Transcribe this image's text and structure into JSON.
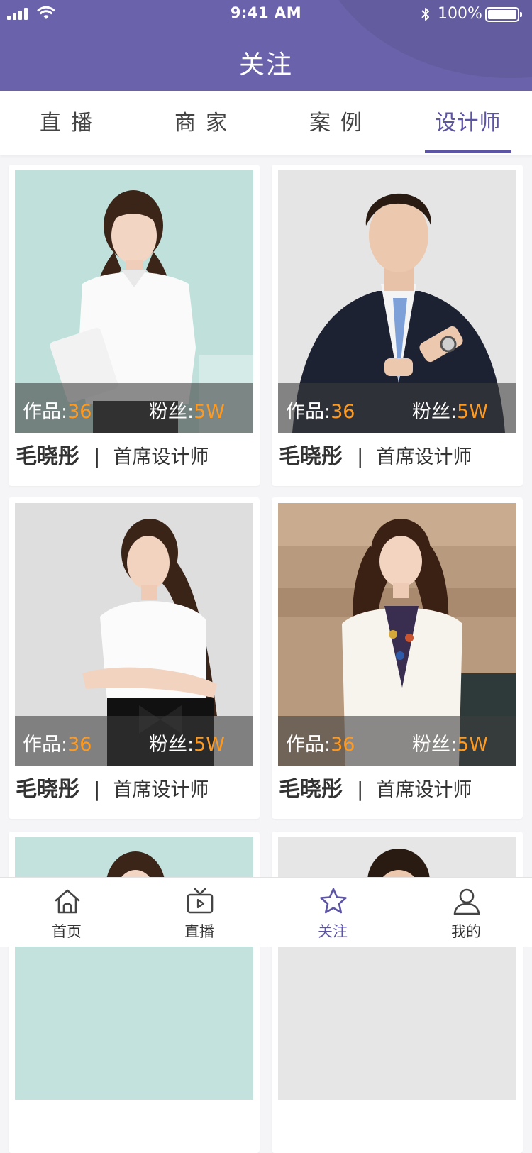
{
  "status_bar": {
    "time": "9:41 AM",
    "battery_text": "100%",
    "battery_level": 1.0
  },
  "header": {
    "title": "关注"
  },
  "tabs": [
    {
      "label": "直播",
      "active": false
    },
    {
      "label": "商家",
      "active": false
    },
    {
      "label": "案例",
      "active": false
    },
    {
      "label": "设计师",
      "active": true
    }
  ],
  "stat_labels": {
    "works": "作品",
    "fans": "粉丝"
  },
  "designers": [
    {
      "name": "毛晓彤",
      "role": "首席设计师",
      "works": "36",
      "fans": "5W",
      "photo": "woman-white-blouse"
    },
    {
      "name": "毛晓彤",
      "role": "首席设计师",
      "works": "36",
      "fans": "5W",
      "photo": "man-dark-suit"
    },
    {
      "name": "毛晓彤",
      "role": "首席设计师",
      "works": "36",
      "fans": "5W",
      "photo": "woman-folded-arms"
    },
    {
      "name": "毛晓彤",
      "role": "首席设计师",
      "works": "36",
      "fans": "5W",
      "photo": "woman-white-blazer"
    }
  ],
  "card_separator": "|",
  "bottom_nav": [
    {
      "label": "首页",
      "icon": "home-icon",
      "active": false
    },
    {
      "label": "直播",
      "icon": "tv-icon",
      "active": false
    },
    {
      "label": "关注",
      "icon": "star-icon",
      "active": true
    },
    {
      "label": "我的",
      "icon": "user-icon",
      "active": false
    }
  ],
  "colors": {
    "header_bg": "#6a63ab",
    "accent": "#5c54a4",
    "stat_value": "#ff9a1f"
  }
}
